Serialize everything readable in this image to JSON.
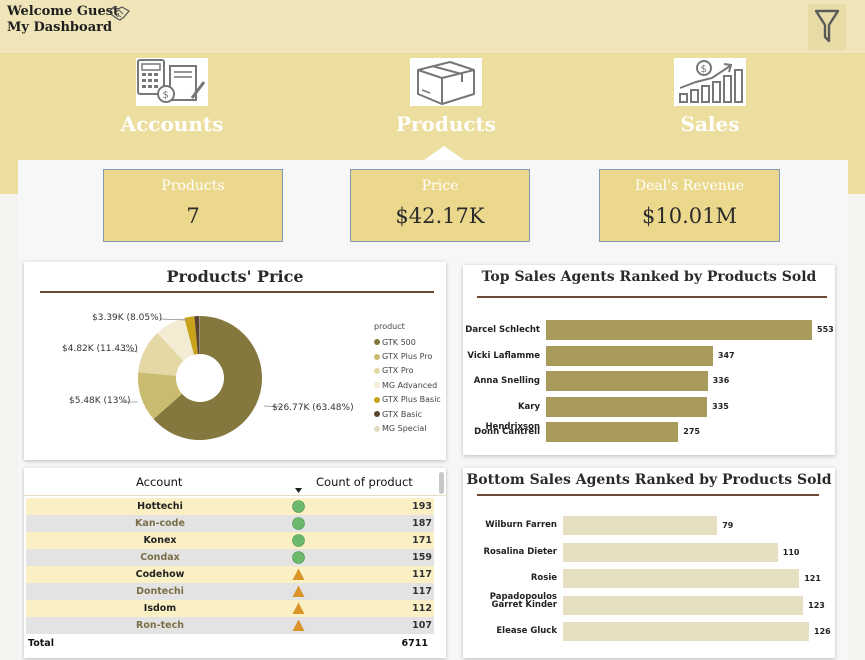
{
  "header": {
    "welcome": "Welcome Guest",
    "dashboard": "My Dashboard",
    "hand_icon": "handshake-icon",
    "filter_icon": "filter-icon"
  },
  "nav": [
    {
      "label": "Accounts",
      "icon": "accounting-calculator-icon"
    },
    {
      "label": "Products",
      "icon": "package-box-icon"
    },
    {
      "label": "Sales",
      "icon": "sales-growth-chart-icon"
    }
  ],
  "kpis": [
    {
      "label": "Products",
      "value": "7"
    },
    {
      "label": "Price",
      "value": "$42.17K"
    },
    {
      "label": "Deal's Revenue",
      "value": "$10.01M"
    }
  ],
  "price_chart": {
    "title": "Products' Price",
    "legend_title": "product",
    "chart_data": {
      "type": "pie",
      "donut": true,
      "labels": [
        "GTK 500",
        "GTX Plus Pro",
        "GTX Pro",
        "MG Advanced",
        "GTX Plus Basic",
        "GTX Basic",
        "MG Special"
      ],
      "values_k": [
        26.77,
        5.48,
        4.82,
        3.39,
        1.1,
        0.55,
        0.06
      ],
      "colors": [
        "#85783e",
        "#c9bc6f",
        "#e3d8a6",
        "#f3ecd3",
        "#c8a21a",
        "#5a4630",
        "#e4dcc6"
      ],
      "data_labels": [
        "$26.77K (63.48%)",
        "$5.48K (13%)",
        "$4.82K (11.43%)",
        "$3.39K (8.05%)"
      ]
    }
  },
  "accounts_table": {
    "headers": {
      "account": "Account",
      "count": "Count of product"
    },
    "rows": [
      {
        "account": "Hottechi",
        "count": "193",
        "status": "circle"
      },
      {
        "account": "Kan-code",
        "count": "187",
        "status": "circle"
      },
      {
        "account": "Konex",
        "count": "171",
        "status": "circle"
      },
      {
        "account": "Condax",
        "count": "159",
        "status": "circle"
      },
      {
        "account": "Codehow",
        "count": "117",
        "status": "triangle"
      },
      {
        "account": "Dontechi",
        "count": "117",
        "status": "triangle"
      },
      {
        "account": "Isdom",
        "count": "112",
        "status": "triangle"
      },
      {
        "account": "Ron-tech",
        "count": "107",
        "status": "triangle"
      }
    ],
    "total_label": "Total",
    "total_value": "6711",
    "colors": {
      "circle": "#6cb96c",
      "triangle": "#d9952a"
    }
  },
  "top_agents": {
    "title": "Top Sales Agents Ranked by Products Sold",
    "chart_data": {
      "type": "bar",
      "orientation": "horizontal",
      "categories": [
        "Darcel Schlecht",
        "Vicki Laflamme",
        "Anna Snelling",
        "Kary Hendrixson",
        "Donn Cantrell"
      ],
      "values": [
        553,
        347,
        336,
        335,
        275
      ],
      "value_labels": [
        "553",
        "347",
        "336",
        "335",
        "275"
      ],
      "color": "#a8995c",
      "xlim": [
        0,
        553
      ]
    }
  },
  "bottom_agents": {
    "title": "Bottom Sales Agents Ranked by Products Sold",
    "chart_data": {
      "type": "bar",
      "orientation": "horizontal",
      "categories": [
        "Wilburn Farren",
        "Rosalina Dieter",
        "Rosie Papadopoulos",
        "Garret Kinder",
        "Elease Gluck"
      ],
      "values": [
        79,
        110,
        121,
        123,
        126
      ],
      "value_labels": [
        "79",
        "110",
        "121",
        "123",
        "126"
      ],
      "color": "#e6dfc1",
      "xlim": [
        0,
        126
      ]
    }
  }
}
